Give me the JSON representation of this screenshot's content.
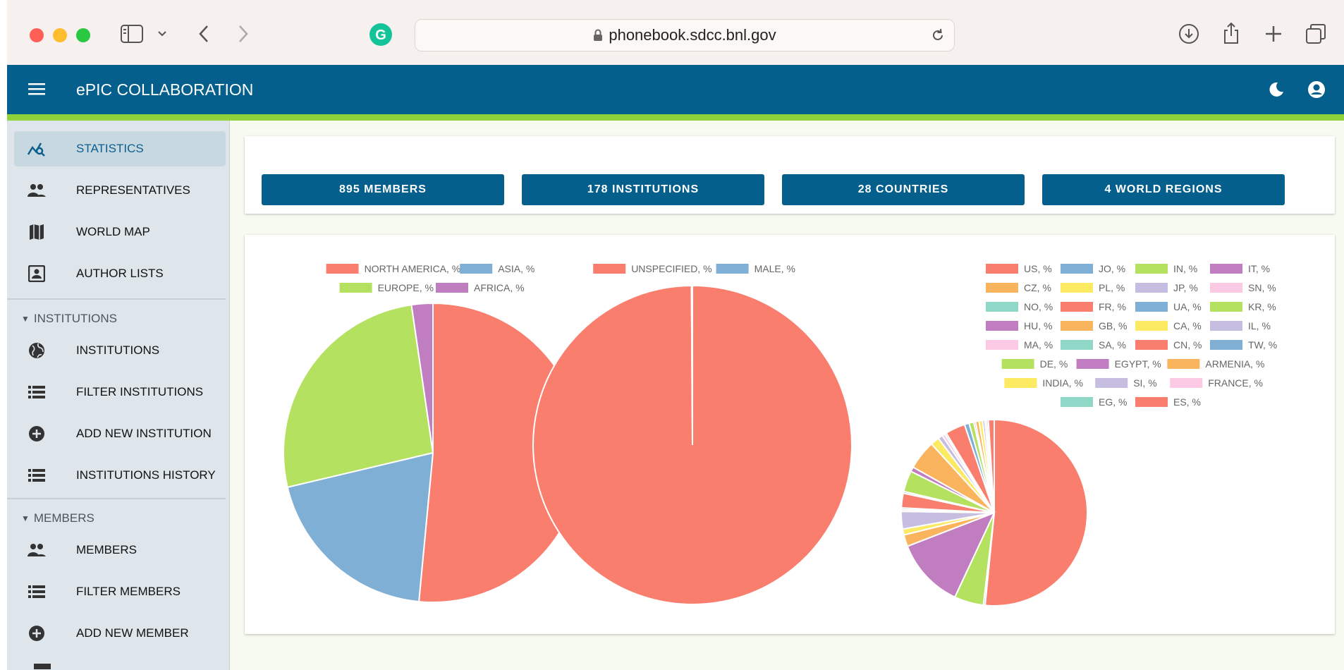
{
  "browser": {
    "url": "phonebook.sdcc.bnl.gov",
    "traffic_colors": [
      "#ff5f57",
      "#febc2e",
      "#28c840"
    ]
  },
  "header": {
    "title": "ePIC COLLABORATION",
    "menu_icon": "menu-icon",
    "right_icons": [
      "dark-mode-icon",
      "account-icon"
    ]
  },
  "sidebar": {
    "items": [
      {
        "label": "STATISTICS",
        "icon": "statistics-icon",
        "active": true
      },
      {
        "label": "REPRESENTATIVES",
        "icon": "people-icon"
      },
      {
        "label": "WORLD MAP",
        "icon": "map-icon"
      },
      {
        "label": "AUTHOR LISTS",
        "icon": "contact-card-icon"
      }
    ],
    "institutions_heading": "INSTITUTIONS",
    "institution_items": [
      {
        "label": "INSTITUTIONS",
        "icon": "globe-icon"
      },
      {
        "label": "FILTER INSTITUTIONS",
        "icon": "list-icon"
      },
      {
        "label": "ADD NEW INSTITUTION",
        "icon": "add-icon"
      },
      {
        "label": "INSTITUTIONS HISTORY",
        "icon": "list-icon"
      }
    ],
    "members_heading": "MEMBERS",
    "member_items": [
      {
        "label": "MEMBERS",
        "icon": "people-icon"
      },
      {
        "label": "FILTER MEMBERS",
        "icon": "list-icon"
      },
      {
        "label": "ADD NEW MEMBER",
        "icon": "add-icon"
      }
    ]
  },
  "stats": {
    "members": "895 MEMBERS",
    "institutions": "178 INSTITUTIONS",
    "countries": "28 COUNTRIES",
    "regions": "4 WORLD REGIONS"
  },
  "chart_data": [
    {
      "type": "pie",
      "title": "",
      "series": [
        {
          "name": "NORTH AMERICA, %",
          "value": 51.5,
          "color": "#fa7e6e"
        },
        {
          "name": "ASIA, %",
          "value": 19.8,
          "color": "#7fafd5"
        },
        {
          "name": "EUROPE, %",
          "value": 26.4,
          "color": "#b4e160"
        },
        {
          "name": "AFRICA, %",
          "value": 2.3,
          "color": "#c07ec1"
        }
      ],
      "legend": "top"
    },
    {
      "type": "pie",
      "title": "",
      "series": [
        {
          "name": "UNSPECIFIED, %",
          "value": 99.9,
          "color": "#fa7e6e"
        },
        {
          "name": "MALE, %",
          "value": 0.1,
          "color": "#7fafd5"
        }
      ],
      "legend": "top"
    },
    {
      "type": "pie",
      "title": "",
      "series": [
        {
          "name": "US, %",
          "value": 50.8,
          "color": "#fa7e6e"
        },
        {
          "name": "JO, %",
          "value": 0.3,
          "color": "#7fafd5"
        },
        {
          "name": "IN, %",
          "value": 5.0,
          "color": "#b4e160"
        },
        {
          "name": "IT, %",
          "value": 12.0,
          "color": "#c07ec1"
        },
        {
          "name": "CZ, %",
          "value": 2.0,
          "color": "#fbb45e"
        },
        {
          "name": "PL, %",
          "value": 1.0,
          "color": "#fbea62"
        },
        {
          "name": "JP, %",
          "value": 3.0,
          "color": "#c5bee0"
        },
        {
          "name": "SN, %",
          "value": 0.3,
          "color": "#fbc9e3"
        },
        {
          "name": "NO, %",
          "value": 0.3,
          "color": "#8fd8c8"
        },
        {
          "name": "FR, %",
          "value": 2.5,
          "color": "#fa7e6e"
        },
        {
          "name": "UA, %",
          "value": 0.3,
          "color": "#7fafd5"
        },
        {
          "name": "KR, %",
          "value": 3.6,
          "color": "#b4e160"
        },
        {
          "name": "HU, %",
          "value": 0.8,
          "color": "#c07ec1"
        },
        {
          "name": "GB, %",
          "value": 5.0,
          "color": "#fbb45e"
        },
        {
          "name": "CA, %",
          "value": 1.5,
          "color": "#fbea62"
        },
        {
          "name": "IL, %",
          "value": 0.8,
          "color": "#c5bee0"
        },
        {
          "name": "MA, %",
          "value": 0.5,
          "color": "#fbc9e3"
        },
        {
          "name": "SA, %",
          "value": 0.3,
          "color": "#8fd8c8"
        },
        {
          "name": "CN, %",
          "value": 3.4,
          "color": "#fa7e6e"
        },
        {
          "name": "TW, %",
          "value": 0.8,
          "color": "#7fafd5"
        },
        {
          "name": "DE, %",
          "value": 0.8,
          "color": "#b4e160"
        },
        {
          "name": "EGYPT, %",
          "value": 0.3,
          "color": "#c07ec1"
        },
        {
          "name": "ARMENIA, %",
          "value": 0.6,
          "color": "#fbb45e"
        },
        {
          "name": "INDIA, %",
          "value": 0.6,
          "color": "#fbea62"
        },
        {
          "name": "SI, %",
          "value": 0.4,
          "color": "#c5bee0"
        },
        {
          "name": "FRANCE, %",
          "value": 0.3,
          "color": "#fbc9e3"
        },
        {
          "name": "EG, %",
          "value": 0.3,
          "color": "#8fd8c8"
        },
        {
          "name": "ES, %",
          "value": 1.0,
          "color": "#fa7e6e"
        }
      ],
      "legend": "top"
    }
  ]
}
